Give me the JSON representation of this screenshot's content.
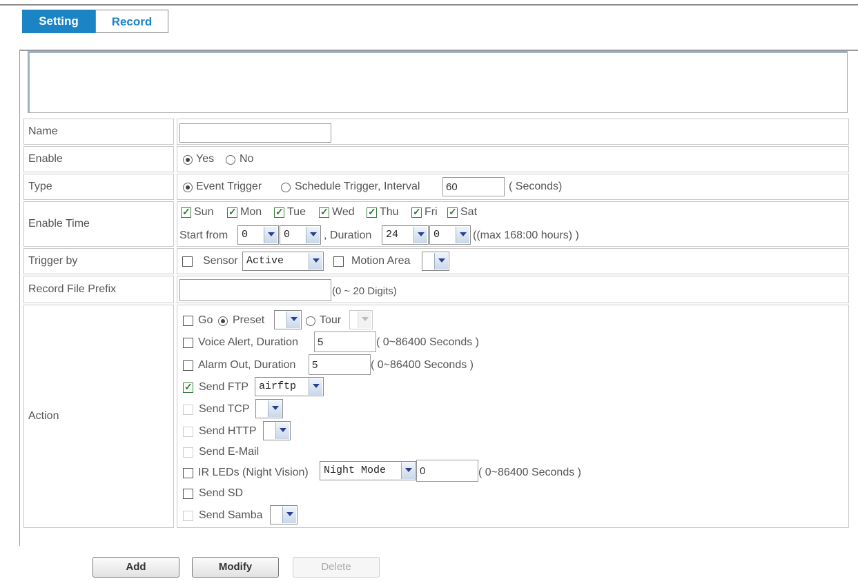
{
  "tabs": {
    "setting": "Setting",
    "record": "Record"
  },
  "form": {
    "name": {
      "label": "Name",
      "value": ""
    },
    "enable": {
      "label": "Enable",
      "yes": "Yes",
      "no": "No",
      "selected": "Yes"
    },
    "type": {
      "label": "Type",
      "event": "Event Trigger",
      "schedule": "Schedule Trigger, Interval",
      "interval": "60",
      "unit": "( Seconds)",
      "selected": "Event Trigger"
    },
    "enable_time": {
      "label": "Enable Time",
      "days": [
        "Sun",
        "Mon",
        "Tue",
        "Wed",
        "Thu",
        "Fri",
        "Sat"
      ],
      "start_label": "Start from",
      "start_hour": "0",
      "start_min": "0",
      "duration_label": ", Duration",
      "duration_hour": "24",
      "duration_min": "0",
      "max_note": "((max 168:00 hours) )"
    },
    "trigger_by": {
      "label": "Trigger by",
      "sensor": "Sensor",
      "sensor_value": "Active",
      "motion": "Motion Area"
    },
    "prefix": {
      "label": "Record File Prefix",
      "value": "",
      "note": "(0 ~ 20 Digits)"
    },
    "action": {
      "label": "Action",
      "go": "Go",
      "preset": "Preset",
      "tour": "Tour",
      "voice_alert": "Voice Alert, Duration",
      "voice_value": "5",
      "voice_note": "( 0~86400 Seconds )",
      "alarm_out": "Alarm Out, Duration",
      "alarm_value": "5",
      "alarm_note": "( 0~86400 Seconds )",
      "send_ftp": "Send FTP",
      "ftp_value": "airftp",
      "send_tcp": "Send TCP",
      "send_http": "Send HTTP",
      "send_email": "Send E-Mail",
      "ir_leds": "IR LEDs (Night Vision)",
      "ir_mode": "Night Mode",
      "ir_value": "0",
      "ir_note": "( 0~86400 Seconds )",
      "send_sd": "Send SD",
      "send_samba": "Send Samba"
    }
  },
  "buttons": {
    "add": "Add",
    "modify": "Modify",
    "delete": "Delete"
  }
}
